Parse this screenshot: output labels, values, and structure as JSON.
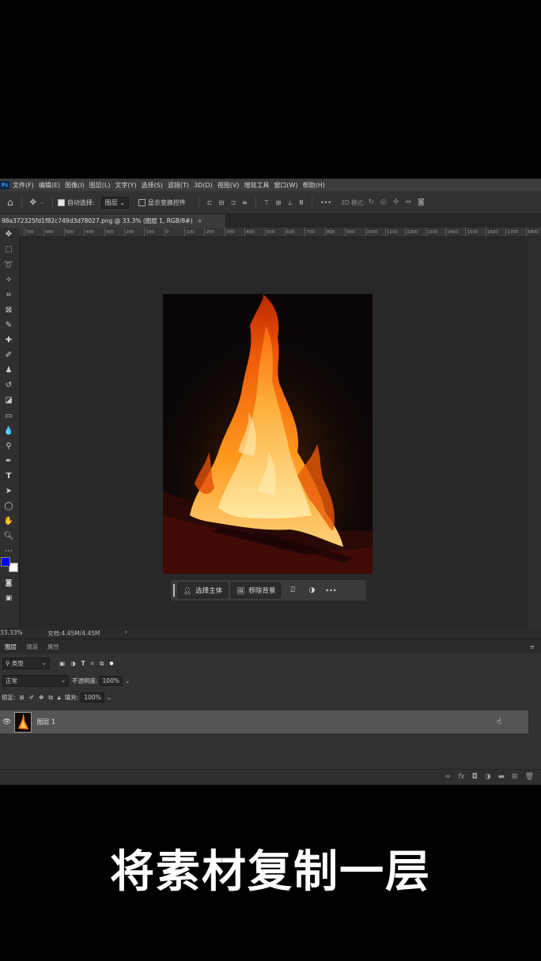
{
  "app": {
    "logo": "Ps",
    "menu": [
      "文件(F)",
      "编辑(E)",
      "图像(I)",
      "图层(L)",
      "文字(Y)",
      "选择(S)",
      "滤镜(T)",
      "3D(D)",
      "视图(V)",
      "增效工具",
      "窗口(W)",
      "帮助(H)"
    ]
  },
  "options": {
    "auto_select_label": "自动选择:",
    "auto_select_value": "图层",
    "show_transform_label": "显示变换控件",
    "more": "•••",
    "mode_3d": "3D 模式:"
  },
  "document": {
    "tab_title": "98a372325fd1f82c749d3d78027.png @ 33.3% (图层 1, RGB/8#)",
    "close": "×"
  },
  "ruler": {
    "ticks": [
      "700",
      "600",
      "500",
      "400",
      "300",
      "200",
      "100",
      "0",
      "100",
      "200",
      "300",
      "400",
      "500",
      "600",
      "700",
      "800",
      "900",
      "1000",
      "1100",
      "1200",
      "1300",
      "1400",
      "1500",
      "1600",
      "1700",
      "1800"
    ]
  },
  "context_bar": {
    "select_subject": "选择主体",
    "remove_background": "移除背景",
    "more": "•••"
  },
  "status": {
    "zoom": "33.33%",
    "doc_info": "文档:4.45M/4.45M",
    "arrow": "›"
  },
  "panel": {
    "tabs": [
      "图层",
      "通道",
      "属性"
    ],
    "filter_label": "类型",
    "blend_mode": "正常",
    "opacity_label": "不透明度:",
    "opacity_value": "100%",
    "lock_label": "锁定:",
    "fill_label": "填充:",
    "fill_value": "100%",
    "layers": [
      {
        "name": "图层 1",
        "visible": true
      }
    ]
  },
  "caption": "将素材复制一层",
  "colors": {
    "foreground": "#0000ff",
    "background": "#ffffff",
    "accent": "#31a8ff"
  }
}
